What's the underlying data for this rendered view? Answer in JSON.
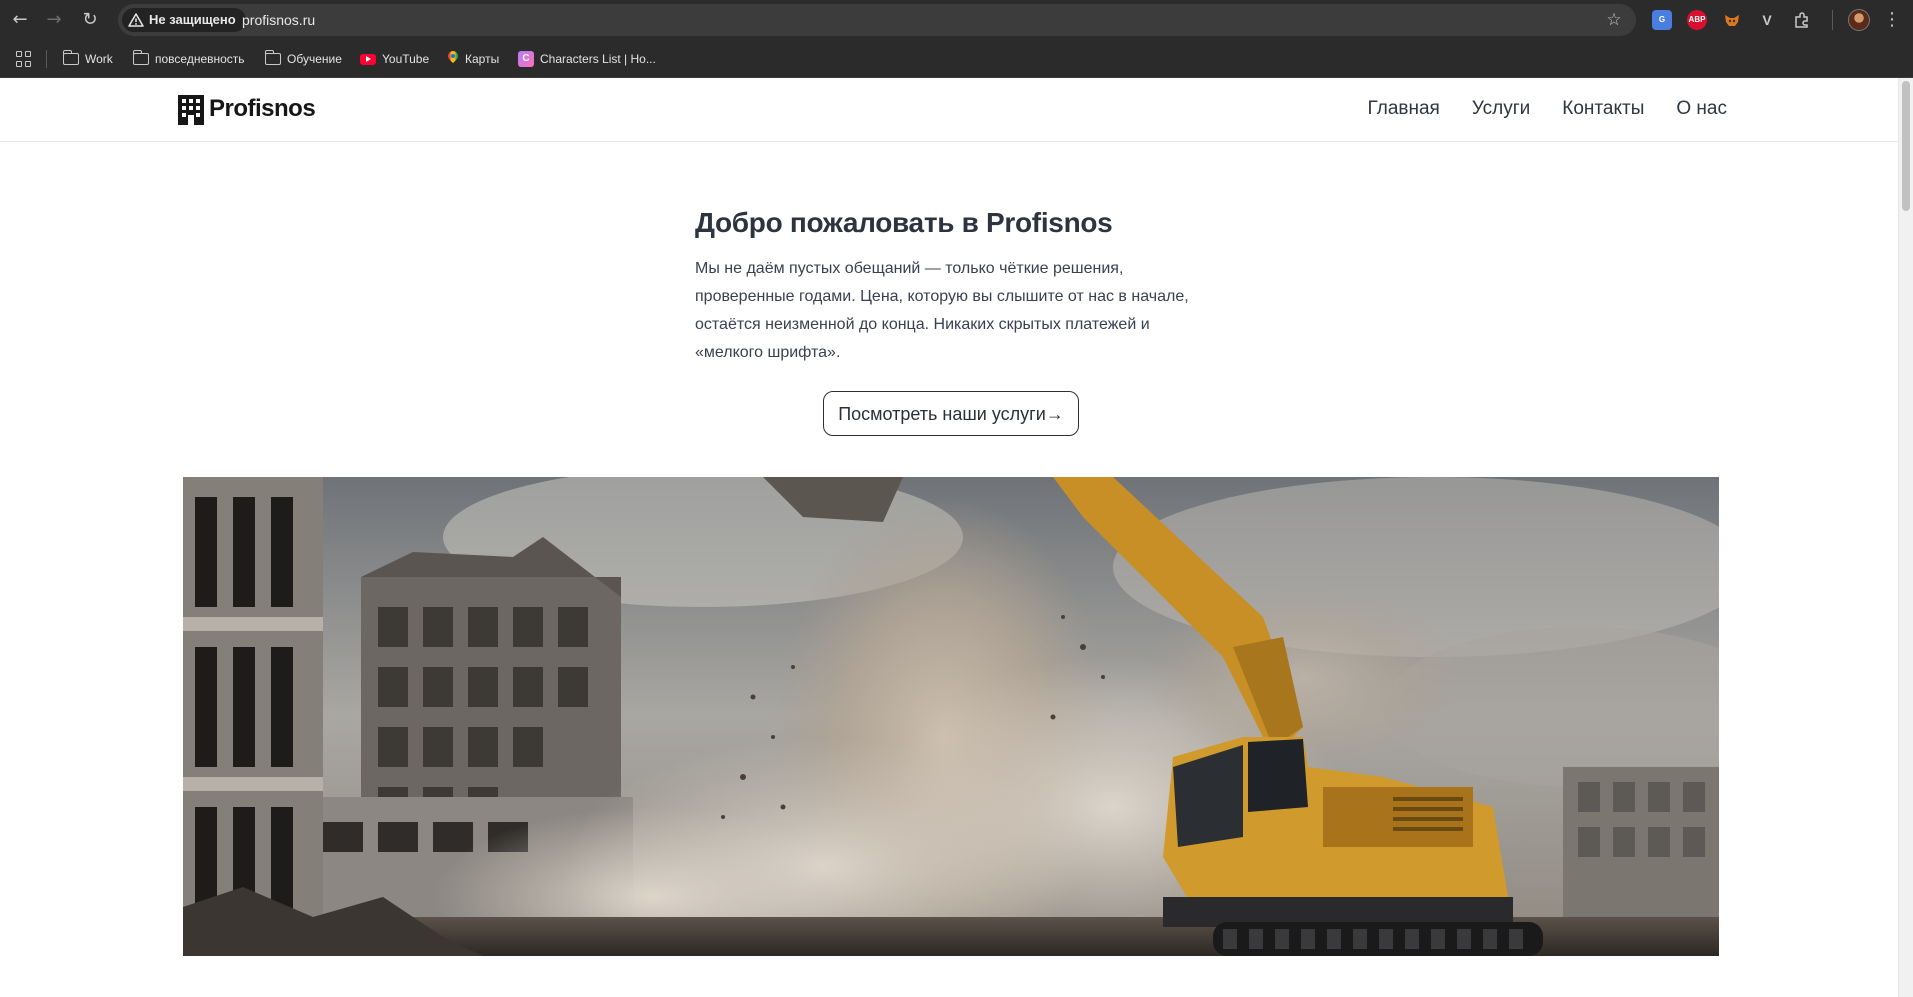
{
  "browser": {
    "security_label": "Не защищено",
    "url": "profisnos.ru",
    "extensions": [
      {
        "name": "translate-extension",
        "label": "G"
      },
      {
        "name": "adblock-extension",
        "label": "ABP"
      },
      {
        "name": "metamask-extension",
        "label": ""
      },
      {
        "name": "vpn-extension",
        "label": "V"
      }
    ]
  },
  "bookmarks": [
    {
      "icon": "folder-icon",
      "label": "Work"
    },
    {
      "icon": "folder-icon",
      "label": "повседневность"
    },
    {
      "icon": "folder-icon",
      "label": "Обучение"
    },
    {
      "icon": "youtube-icon",
      "label": "YouTube"
    },
    {
      "icon": "maps-icon",
      "label": "Карты"
    },
    {
      "icon": "characters-icon",
      "label": "Characters List | Ho..."
    }
  ],
  "site": {
    "logo_text": "Profisnos",
    "nav": [
      {
        "label": "Главная"
      },
      {
        "label": "Услуги"
      },
      {
        "label": "Контакты"
      },
      {
        "label": "О нас"
      }
    ]
  },
  "hero": {
    "title": "Добро пожаловать в Profisnos",
    "text": "Мы не даём пустых обещаний — только чёткие решения, проверенные годами. Цена, которую вы слышите от нас в начале, остаётся неизменной до конца. Никаких скрытых платежей и «мелкого шрифта».",
    "cta_label": "Посмотреть наши услуги→"
  },
  "hero_image": {
    "subject": "excavator demolishing building with dust cloud",
    "excavator_color": "#d09a2c"
  }
}
